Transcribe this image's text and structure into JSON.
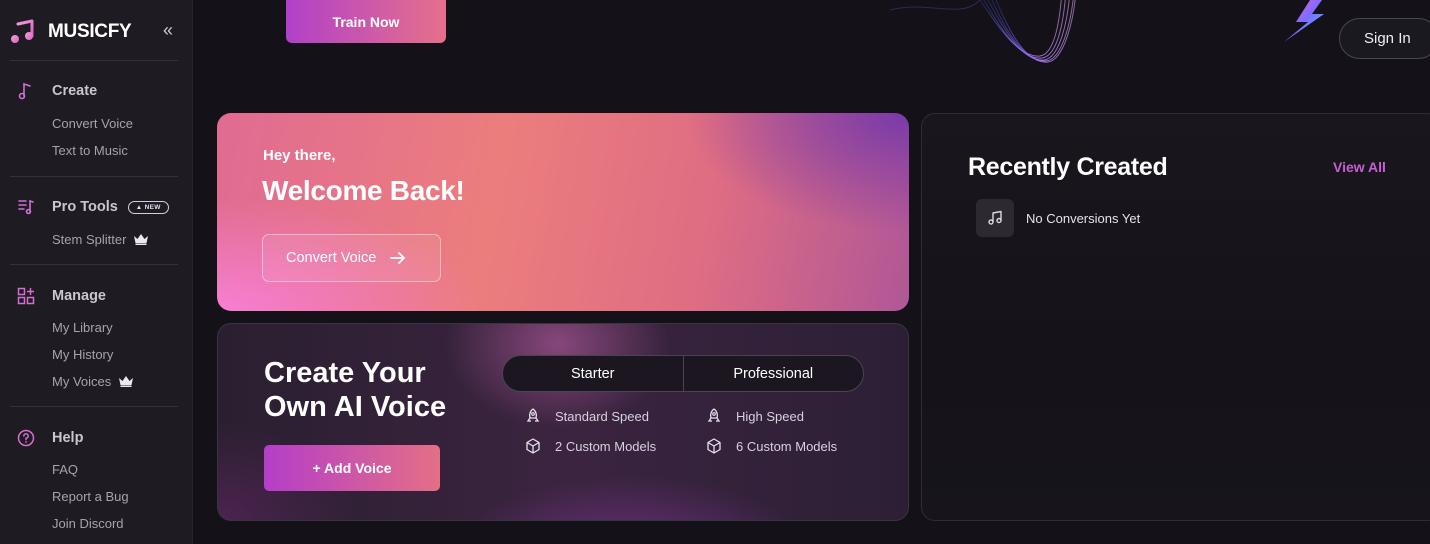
{
  "brand": {
    "name": "MUSICFY"
  },
  "sidebar": {
    "collapse_icon": "chevrons-left-icon",
    "sections": [
      {
        "label": "Create",
        "icon": "music-note-icon",
        "items": [
          {
            "label": "Convert Voice"
          },
          {
            "label": "Text to Music"
          }
        ]
      },
      {
        "label": "Pro Tools",
        "icon": "audio-list-icon",
        "badge": "NEW",
        "items": [
          {
            "label": "Stem Splitter",
            "premium": true
          }
        ]
      },
      {
        "label": "Manage",
        "icon": "grid-add-icon",
        "items": [
          {
            "label": "My Library"
          },
          {
            "label": "My History"
          },
          {
            "label": "My Voices",
            "premium": true
          }
        ]
      },
      {
        "label": "Help",
        "icon": "help-circle-icon",
        "items": [
          {
            "label": "FAQ"
          },
          {
            "label": "Report a Bug"
          },
          {
            "label": "Join Discord"
          }
        ]
      }
    ]
  },
  "header": {
    "train_button": "Train Now",
    "signin_button": "Sign In"
  },
  "welcome": {
    "greeting": "Hey there,",
    "title": "Welcome Back!",
    "cta": "Convert Voice"
  },
  "voice_promo": {
    "title": "Create Your Own AI Voice",
    "cta": "+ Add Voice",
    "tabs": [
      "Starter",
      "Professional"
    ],
    "starter_features": [
      "Standard Speed",
      "2 Custom Models"
    ],
    "professional_features": [
      "High Speed",
      "6 Custom Models"
    ]
  },
  "recent": {
    "title": "Recently Created",
    "view_all": "View All",
    "empty_text": "No Conversions Yet"
  },
  "colors": {
    "accent_purple": "#c460d4",
    "gradient_start": "#b140c9",
    "gradient_end": "#e6708a",
    "sidebar_bg": "#1e1c22",
    "page_bg": "#141218"
  }
}
